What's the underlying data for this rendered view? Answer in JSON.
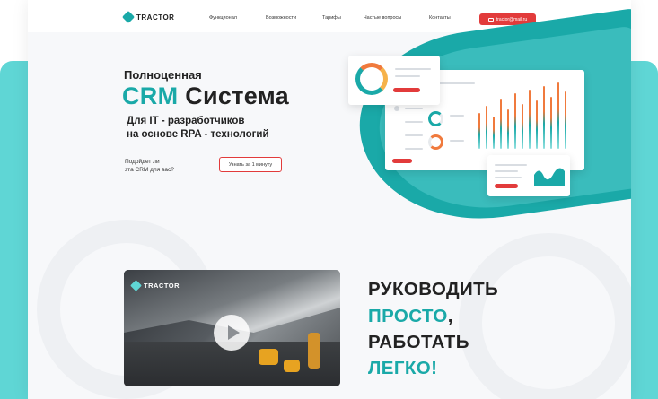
{
  "header": {
    "logo_text": "TRACTOR",
    "nav": [
      "Функционал",
      "Возможности",
      "Тарифы",
      "Частые вопросы",
      "Контакты"
    ],
    "email": "tractor@mail.ru"
  },
  "hero": {
    "title_line1": "Полноценная",
    "title_accent": "CRM",
    "title_rest": " Система",
    "subtitle_line1": "Для IT - разработчиков",
    "subtitle_line2": "на основе RPA - технологий",
    "question_line1": "Подойдет ли",
    "question_line2": "эта CRM для вас?",
    "cta": "Узнать за 1 минуту"
  },
  "video": {
    "logo_text": "TRACTOR"
  },
  "slogan": {
    "line1": "РУКОВОДИТЬ",
    "line2_accent": "ПРОСТО",
    "line2_comma": ",",
    "line3": "РАБОТАТЬ",
    "line4_accent": "ЛЕГКО!"
  },
  "colors": {
    "accent": "#1aa9a8",
    "red": "#e23b3b"
  }
}
